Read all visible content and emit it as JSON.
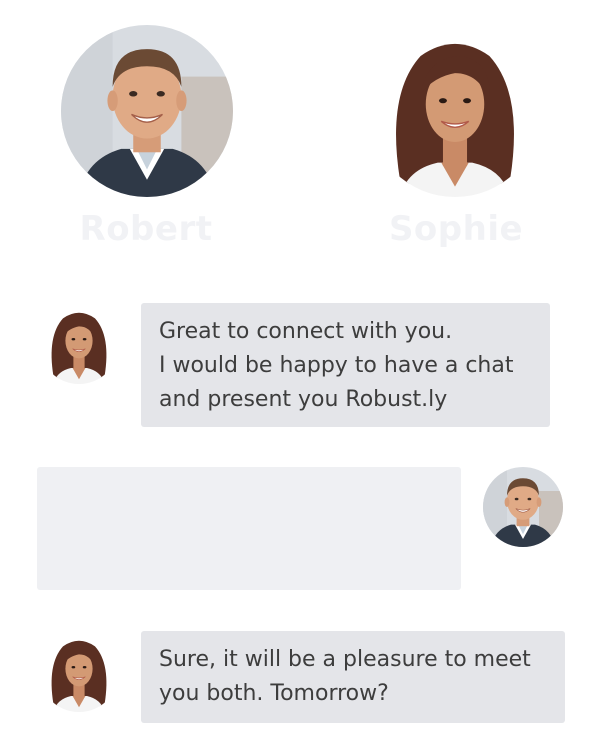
{
  "participants": {
    "robert": {
      "name": "Robert",
      "icon": "man-portrait-icon"
    },
    "sophie": {
      "name": "Sophie",
      "icon": "woman-portrait-icon"
    }
  },
  "messages": [
    {
      "sender": "Sophie",
      "side": "left",
      "lines": [
        "Great to connect with you.",
        "I would be happy to have a chat",
        "and present you Robust.ly"
      ]
    },
    {
      "sender": "Robert",
      "side": "right",
      "lines": []
    },
    {
      "sender": "Sophie",
      "side": "left",
      "lines": [
        "Sure, it will be a pleasure to meet",
        "you both. Tomorrow?"
      ]
    }
  ],
  "colors": {
    "bubble": "#e4e5e9",
    "bubble_blank": "#eff0f3",
    "name_text": "#f1f2f5",
    "message_text": "#3d3d3d"
  }
}
